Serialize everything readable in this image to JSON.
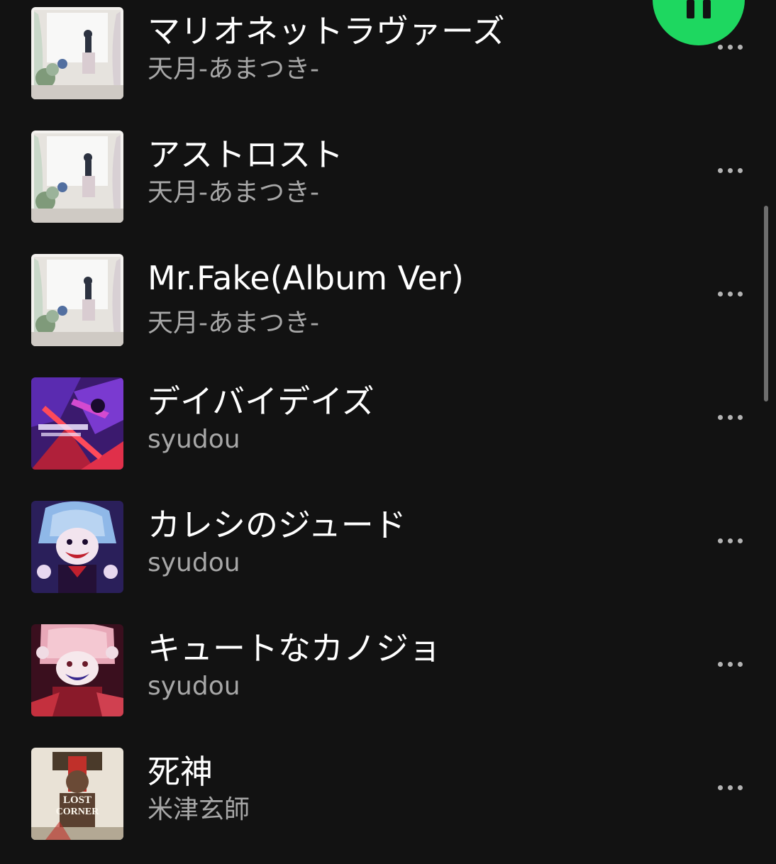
{
  "tracks": [
    {
      "title": "マリオネットラヴァーズ",
      "artist": "天月-あまつき-",
      "cover": "amatsuki-album-cover"
    },
    {
      "title": "アストロスト",
      "artist": "天月-あまつき-",
      "cover": "amatsuki-album-cover"
    },
    {
      "title": "Mr.Fake(Album Ver)",
      "artist": "天月-あまつき-",
      "cover": "amatsuki-album-cover"
    },
    {
      "title": "デイバイデイズ",
      "artist": "syudou",
      "cover": "daybydays-cover"
    },
    {
      "title": "カレシのジュード",
      "artist": "syudou",
      "cover": "kareshi-no-jude-cover"
    },
    {
      "title": "キュートなカノジョ",
      "artist": "syudou",
      "cover": "cute-na-kanojo-cover"
    },
    {
      "title": "死神",
      "artist": "米津玄師",
      "cover": "lost-corner-cover"
    }
  ],
  "covers": {
    "lost_corner_text_1": "LOST",
    "lost_corner_text_2": "CORNER"
  },
  "icons": {
    "more": "more-options-icon",
    "play_pause": "pause-icon"
  },
  "colors": {
    "background": "#121212",
    "accent": "#1ed760",
    "title": "#ffffff",
    "subtitle": "#a7a7a7"
  }
}
